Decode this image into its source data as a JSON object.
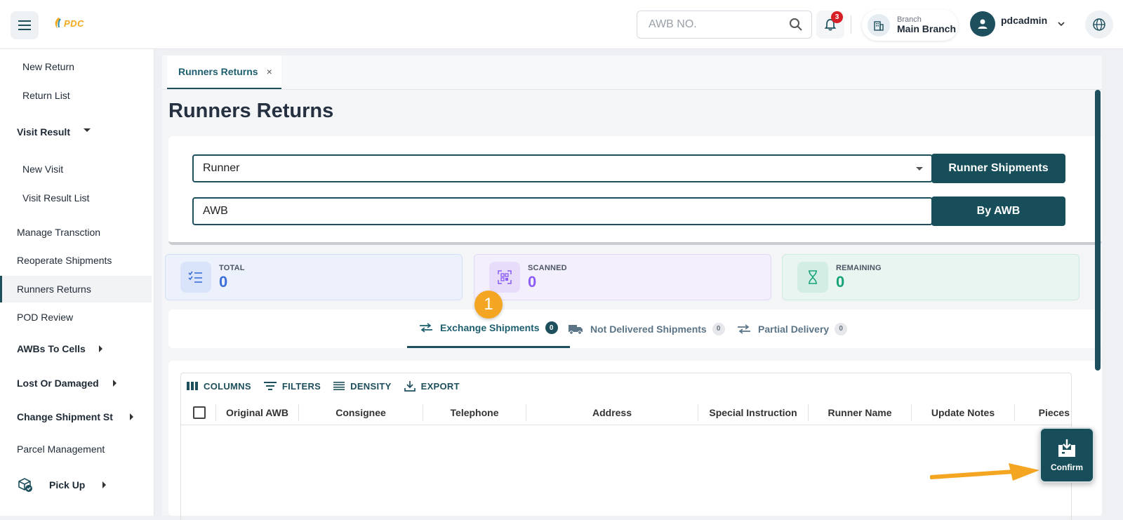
{
  "header": {
    "logo_text": "PDC",
    "search_placeholder": "AWB NO.",
    "notification_count": "3",
    "branch_label": "Branch",
    "branch_value": "Main Branch",
    "username": "pdcadmin"
  },
  "sidebar": {
    "items": [
      {
        "label": "New Return"
      },
      {
        "label": "Return List"
      },
      {
        "label": "Visit Result"
      },
      {
        "label": "New Visit"
      },
      {
        "label": "Visit Result List"
      },
      {
        "label": "Manage Transction"
      },
      {
        "label": "Reoperate Shipments"
      },
      {
        "label": "Runners Returns"
      },
      {
        "label": "POD Review"
      },
      {
        "label": "AWBs To Cells"
      },
      {
        "label": "Lost Or Damaged"
      },
      {
        "label": "Change Shipment Sta"
      },
      {
        "label": "Parcel Management"
      },
      {
        "label": "Pick Up"
      }
    ]
  },
  "main": {
    "tab_label": "Runners Returns",
    "tab_close": "×",
    "page_title": "Runners Returns",
    "runner_field": "Runner",
    "awb_field": "AWB",
    "runner_shipments_button": "Runner Shipments",
    "by_awb_button": "By AWB",
    "stats": {
      "total_label": "TOTAL",
      "total_value": "0",
      "scanned_label": "SCANNED",
      "scanned_value": "0",
      "remaining_label": "REMAINING",
      "remaining_value": "0"
    },
    "shipment_tabs": [
      {
        "label": "Exchange Shipments",
        "count": "0"
      },
      {
        "label": "Not Delivered Shipments",
        "count": "0"
      },
      {
        "label": "Partial Delivery",
        "count": "0"
      }
    ],
    "toolbar": {
      "columns": "COLUMNS",
      "filters": "FILTERS",
      "density": "DENSITY",
      "export": "EXPORT"
    },
    "columns": [
      "Original AWB",
      "Consignee",
      "Telephone",
      "Address",
      "Special Instruction",
      "Runner Name",
      "Update Notes",
      "Pieces"
    ],
    "confirm_label": "Confirm",
    "step_number": "1"
  },
  "colors": {
    "primary": "#174e5a",
    "accent": "#f4a623",
    "badge": "#d61f26",
    "total": "#3b6fd8",
    "scanned": "#8b5cf6",
    "remaining": "#16a37a"
  }
}
